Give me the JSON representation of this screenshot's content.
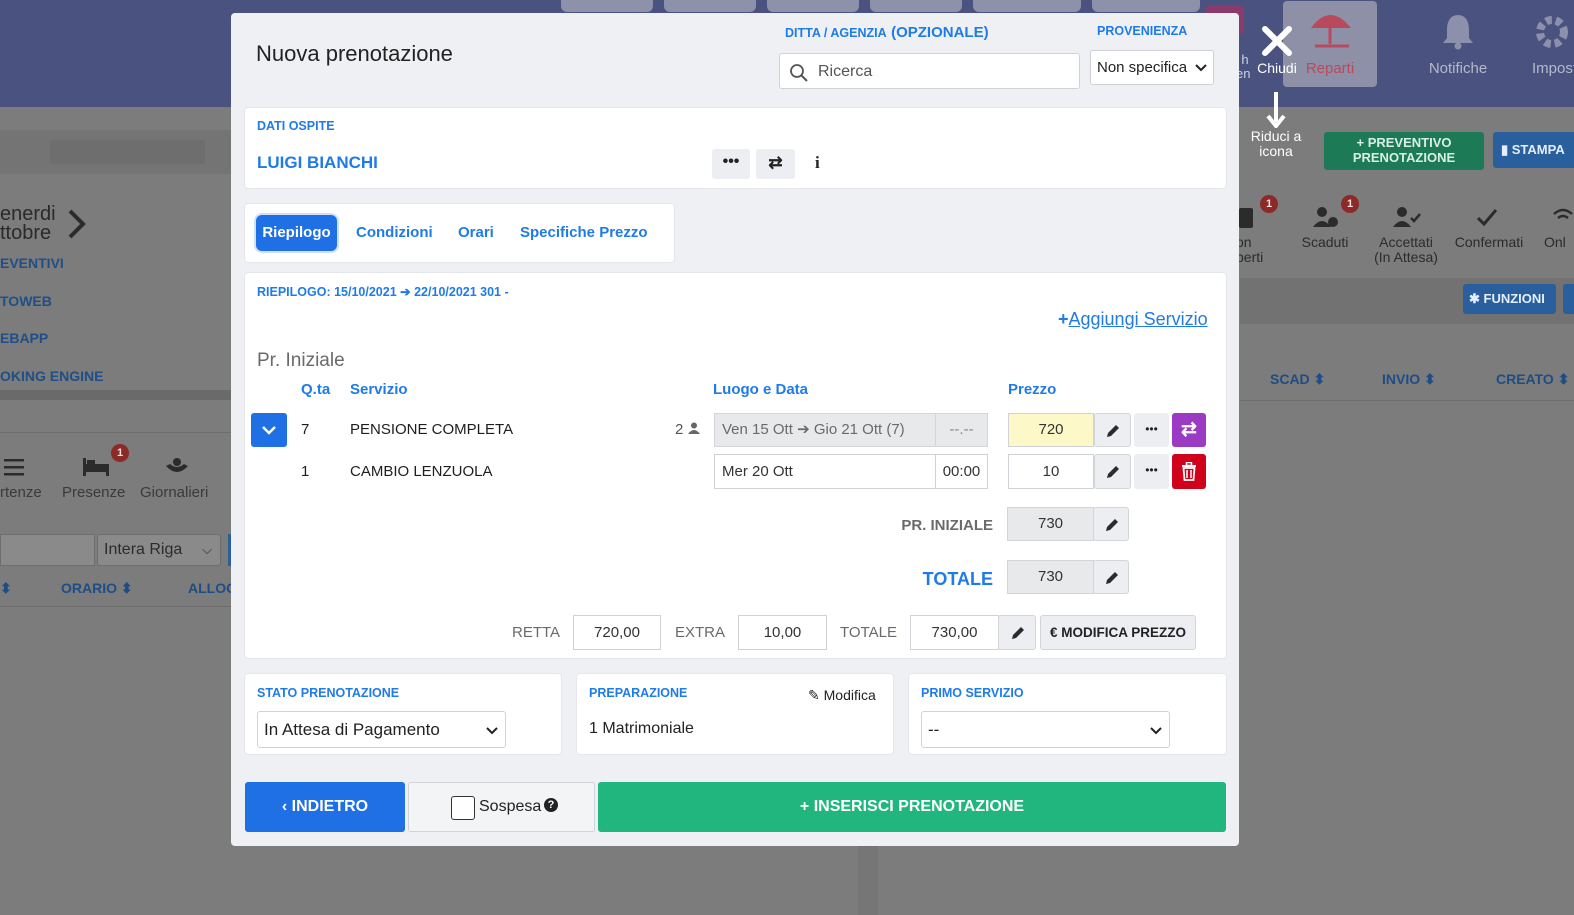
{
  "background": {
    "topbar_items": [
      {
        "label": "Reparti",
        "icon": "beach-umbrella-icon"
      },
      {
        "label": "Notifiche",
        "icon": "bell-icon"
      },
      {
        "label": "Impostaz",
        "icon": "gear-icon"
      }
    ],
    "partial_h": "h",
    "partial_en": "en",
    "buttons": {
      "preventivo": "+ PREVENTIVO PRENOTAZIONE",
      "stampa": "STAMPA",
      "funzioni": "FUNZIONI"
    },
    "date_nav": {
      "day": "enerdi",
      "month": "ttobre"
    },
    "side_links": [
      "EVENTIVI",
      "TOWEB",
      "EBAPP",
      "OKING ENGINE"
    ],
    "status_items": [
      {
        "label": "on\nperti",
        "badge": "1"
      },
      {
        "label": "Scaduti",
        "badge": "1"
      },
      {
        "label": "Accettati\n(In Attesa)",
        "badge": ""
      },
      {
        "label": "Confermati",
        "badge": ""
      },
      {
        "label": "Onl",
        "badge": ""
      }
    ],
    "left_toolbar": [
      {
        "label": "rtenze",
        "icon": "list-icon",
        "badge": ""
      },
      {
        "label": "Presenze",
        "icon": "bed-icon",
        "badge": "1"
      },
      {
        "label": "Giornalieri",
        "icon": "hands-icon",
        "badge": ""
      }
    ],
    "filter_select": "Intera Riga",
    "table_cols_left": [
      "ORARIO",
      "ALLOG"
    ],
    "table_cols_right": [
      "SCAD",
      "INVIO",
      "CREATO"
    ]
  },
  "close": {
    "label": "Chiudi",
    "minimize_label": "Riduci a icona"
  },
  "modal": {
    "title": "Nuova prenotazione",
    "agency": {
      "label_a": "DITTA / AGENZIA",
      "label_b": "(OPZIONALE)",
      "placeholder": "Ricerca"
    },
    "provenienza": {
      "label": "PROVENIENZA",
      "value": "Non specifica"
    },
    "guest": {
      "section_label": "DATI OSPITE",
      "name": "LUIGI BIANCHI"
    },
    "tabs": [
      "Riepilogo",
      "Condizioni",
      "Orari",
      "Specifiche Prezzo"
    ],
    "summary": {
      "header": "RIEPILOGO: 15/10/2021",
      "header_b": "22/10/2021 301 -",
      "add_service": "Aggiungi Servizio",
      "group_title": "Pr. Iniziale",
      "columns": {
        "qty": "Q.ta",
        "service": "Servizio",
        "place": "Luogo e Data",
        "price": "Prezzo"
      },
      "rows": [
        {
          "qty": "7",
          "service": "PENSIONE COMPLETA",
          "persons": "2",
          "date": "Ven 15 Ott",
          "date_b": "Gio 21 Ott (7)",
          "time": "--.--",
          "price": "720"
        },
        {
          "qty": "1",
          "service": "CAMBIO LENZUOLA",
          "persons": "",
          "date": "Mer 20 Ott",
          "date_b": "",
          "time": "00:00",
          "price": "10"
        }
      ],
      "pr_iniziale_label": "PR. INIZIALE",
      "pr_iniziale_value": "730",
      "totale_label": "TOTALE",
      "totale_value": "730",
      "retta_label": "RETTA",
      "retta_value": "720,00",
      "extra_label": "EXTRA",
      "extra_value": "10,00",
      "totale2_label": "TOTALE",
      "totale2_value": "730,00",
      "modifica_prezzo": "€ MODIFICA PREZZO"
    },
    "stato": {
      "label": "STATO PRENOTAZIONE",
      "value": "In Attesa di Pagamento"
    },
    "preparazione": {
      "label": "PREPARAZIONE",
      "edit": "Modifica",
      "value": "1 Matrimoniale"
    },
    "primo_servizio": {
      "label": "PRIMO SERVIZIO",
      "value": "--"
    },
    "footer": {
      "back": "INDIETRO",
      "sospesa": "Sospesa",
      "insert": "INSERISCI PRENOTAZIONE"
    }
  },
  "colors": {
    "accent": "#1f6fe5",
    "success": "#22b67f",
    "danger": "#d0021b",
    "purple": "#9b3bc4",
    "highlight": "#fdf8c8"
  }
}
